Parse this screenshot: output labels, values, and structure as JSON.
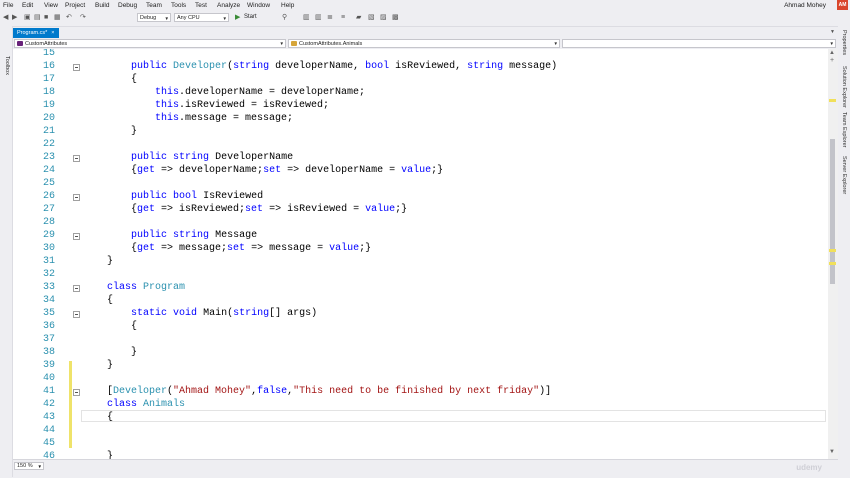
{
  "menu": [
    "File",
    "Edit",
    "View",
    "Project",
    "Build",
    "Debug",
    "Team",
    "Tools",
    "Test",
    "Analyze",
    "Window",
    "Help"
  ],
  "user": {
    "name": "Ahmad Mohey",
    "initials": "AM"
  },
  "toolbar": {
    "config": "Debug",
    "platform": "Any CPU",
    "start": "Start"
  },
  "side": {
    "toolbox": "Toolbox",
    "right": [
      "Properties",
      "Solution Explorer",
      "Team Explorer",
      "Server Explorer"
    ]
  },
  "tab": {
    "label": "Program.cs*",
    "close": "×"
  },
  "nav": {
    "project": "CustomAttributes",
    "type": "CustomAttributes.Animals",
    "member": ""
  },
  "zoom": "150 %",
  "watermark": "udemy",
  "lines": [
    {
      "n": "15",
      "fold": false,
      "tokens": []
    },
    {
      "n": "16",
      "fold": true,
      "tokens": [
        [
          "",
          "        "
        ],
        [
          "kw",
          "public"
        ],
        [
          "",
          " "
        ],
        [
          "ty",
          "Developer"
        ],
        [
          "",
          "("
        ],
        [
          "kw",
          "string"
        ],
        [
          "",
          " developerName, "
        ],
        [
          "kw",
          "bool"
        ],
        [
          "",
          " isReviewed, "
        ],
        [
          "kw",
          "string"
        ],
        [
          "",
          " message)"
        ]
      ]
    },
    {
      "n": "17",
      "fold": false,
      "tokens": [
        [
          "",
          "        {"
        ]
      ]
    },
    {
      "n": "18",
      "fold": false,
      "tokens": [
        [
          "",
          "            "
        ],
        [
          "kw",
          "this"
        ],
        [
          "",
          ".developerName = developerName;"
        ]
      ]
    },
    {
      "n": "19",
      "fold": false,
      "tokens": [
        [
          "",
          "            "
        ],
        [
          "kw",
          "this"
        ],
        [
          "",
          ".isReviewed = isReviewed;"
        ]
      ]
    },
    {
      "n": "20",
      "fold": false,
      "tokens": [
        [
          "",
          "            "
        ],
        [
          "kw",
          "this"
        ],
        [
          "",
          ".message = message;"
        ]
      ]
    },
    {
      "n": "21",
      "fold": false,
      "tokens": [
        [
          "",
          "        }"
        ]
      ]
    },
    {
      "n": "22",
      "fold": false,
      "tokens": []
    },
    {
      "n": "23",
      "fold": true,
      "tokens": [
        [
          "",
          "        "
        ],
        [
          "kw",
          "public"
        ],
        [
          "",
          " "
        ],
        [
          "kw",
          "string"
        ],
        [
          "",
          " DeveloperName"
        ]
      ]
    },
    {
      "n": "24",
      "fold": false,
      "tokens": [
        [
          "",
          "        {"
        ],
        [
          "kw",
          "get"
        ],
        [
          "",
          " => developerName;"
        ],
        [
          "kw",
          "set"
        ],
        [
          "",
          " => developerName = "
        ],
        [
          "kw",
          "value"
        ],
        [
          "",
          ";}"
        ]
      ]
    },
    {
      "n": "25",
      "fold": false,
      "tokens": []
    },
    {
      "n": "26",
      "fold": true,
      "tokens": [
        [
          "",
          "        "
        ],
        [
          "kw",
          "public"
        ],
        [
          "",
          " "
        ],
        [
          "kw",
          "bool"
        ],
        [
          "",
          " IsReviewed"
        ]
      ]
    },
    {
      "n": "27",
      "fold": false,
      "tokens": [
        [
          "",
          "        {"
        ],
        [
          "kw",
          "get"
        ],
        [
          "",
          " => isReviewed;"
        ],
        [
          "kw",
          "set"
        ],
        [
          "",
          " => isReviewed = "
        ],
        [
          "kw",
          "value"
        ],
        [
          "",
          ";}"
        ]
      ]
    },
    {
      "n": "28",
      "fold": false,
      "tokens": []
    },
    {
      "n": "29",
      "fold": true,
      "tokens": [
        [
          "",
          "        "
        ],
        [
          "kw",
          "public"
        ],
        [
          "",
          " "
        ],
        [
          "kw",
          "string"
        ],
        [
          "",
          " Message"
        ]
      ]
    },
    {
      "n": "30",
      "fold": false,
      "tokens": [
        [
          "",
          "        {"
        ],
        [
          "kw",
          "get"
        ],
        [
          "",
          " => message;"
        ],
        [
          "kw",
          "set"
        ],
        [
          "",
          " => message = "
        ],
        [
          "kw",
          "value"
        ],
        [
          "",
          ";}"
        ]
      ]
    },
    {
      "n": "31",
      "fold": false,
      "tokens": [
        [
          "",
          "    }"
        ]
      ]
    },
    {
      "n": "32",
      "fold": false,
      "tokens": []
    },
    {
      "n": "33",
      "fold": true,
      "tokens": [
        [
          "",
          "    "
        ],
        [
          "kw",
          "class"
        ],
        [
          "",
          " "
        ],
        [
          "ty",
          "Program"
        ]
      ]
    },
    {
      "n": "34",
      "fold": false,
      "tokens": [
        [
          "",
          "    {"
        ]
      ]
    },
    {
      "n": "35",
      "fold": true,
      "tokens": [
        [
          "",
          "        "
        ],
        [
          "kw",
          "static"
        ],
        [
          "",
          " "
        ],
        [
          "kw",
          "void"
        ],
        [
          "",
          " Main("
        ],
        [
          "kw",
          "string"
        ],
        [
          "",
          "[] args)"
        ]
      ]
    },
    {
      "n": "36",
      "fold": false,
      "tokens": [
        [
          "",
          "        {"
        ]
      ]
    },
    {
      "n": "37",
      "fold": false,
      "tokens": []
    },
    {
      "n": "38",
      "fold": false,
      "tokens": [
        [
          "",
          "        }"
        ]
      ]
    },
    {
      "n": "39",
      "fold": false,
      "tokens": [
        [
          "",
          "    }"
        ]
      ]
    },
    {
      "n": "40",
      "fold": false,
      "tokens": []
    },
    {
      "n": "41",
      "fold": true,
      "tokens": [
        [
          "",
          "    ["
        ],
        [
          "ty",
          "Developer"
        ],
        [
          "",
          "("
        ],
        [
          "st",
          "\"Ahmad Mohey\""
        ],
        [
          "",
          ","
        ],
        [
          "kw",
          "false"
        ],
        [
          "",
          ","
        ],
        [
          "st",
          "\"This need to be finished by next friday\""
        ],
        [
          "",
          ")]"
        ]
      ]
    },
    {
      "n": "42",
      "fold": false,
      "tokens": [
        [
          "",
          "    "
        ],
        [
          "kw",
          "class"
        ],
        [
          "",
          " "
        ],
        [
          "ty",
          "Animals"
        ]
      ]
    },
    {
      "n": "43",
      "fold": false,
      "tokens": [
        [
          "",
          "    {"
        ]
      ]
    },
    {
      "n": "44",
      "fold": false,
      "tokens": []
    },
    {
      "n": "45",
      "fold": false,
      "tokens": []
    },
    {
      "n": "46",
      "fold": false,
      "tokens": [
        [
          "",
          "    }"
        ]
      ]
    },
    {
      "n": "",
      "fold": false,
      "tokens": [
        [
          "",
          "}"
        ]
      ]
    }
  ]
}
